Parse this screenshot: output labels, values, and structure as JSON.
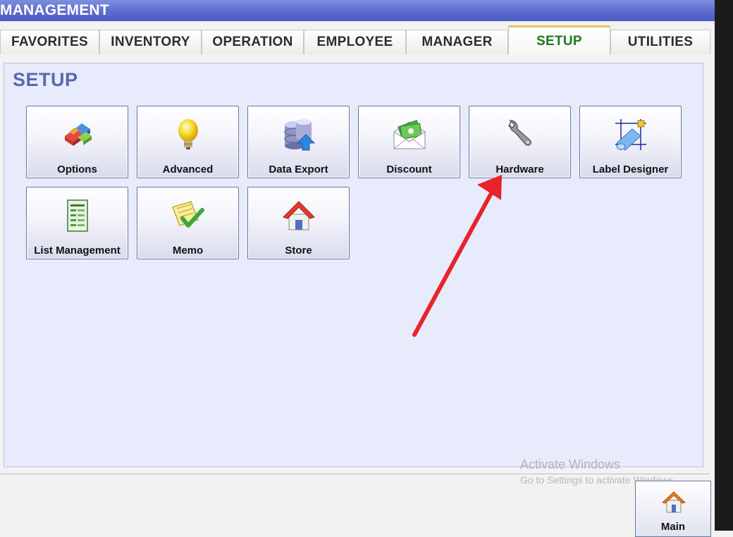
{
  "window": {
    "title": "MANAGEMENT"
  },
  "tabs": [
    {
      "label": "FAVORITES"
    },
    {
      "label": "INVENTORY"
    },
    {
      "label": "OPERATION"
    },
    {
      "label": "EMPLOYEE"
    },
    {
      "label": "MANAGER"
    },
    {
      "label": "SETUP",
      "active": true
    },
    {
      "label": "UTILITIES"
    }
  ],
  "panel": {
    "title": "SETUP"
  },
  "buttons": [
    {
      "label": "Options",
      "icon": "options-icon"
    },
    {
      "label": "Advanced",
      "icon": "lightbulb-icon"
    },
    {
      "label": "Data Export",
      "icon": "database-export-icon"
    },
    {
      "label": "Discount",
      "icon": "envelope-money-icon"
    },
    {
      "label": "Hardware",
      "icon": "wrench-icon"
    },
    {
      "label": "Label Designer",
      "icon": "label-designer-icon"
    },
    {
      "label": "List Management",
      "icon": "list-sheet-icon"
    },
    {
      "label": "Memo",
      "icon": "memo-check-icon"
    },
    {
      "label": "Store",
      "icon": "house-icon"
    }
  ],
  "watermark": {
    "line1": "Activate Windows",
    "line2": "Go to Settings to activate Windows."
  },
  "main_button": {
    "label": "Main",
    "icon": "house-icon"
  },
  "colors": {
    "title_bar": "#5b6ccf",
    "active_tab_text": "#1c7c1c",
    "panel_bg": "#e8ebfb",
    "panel_title": "#5a68b0",
    "annotation_arrow": "#e8232a"
  }
}
